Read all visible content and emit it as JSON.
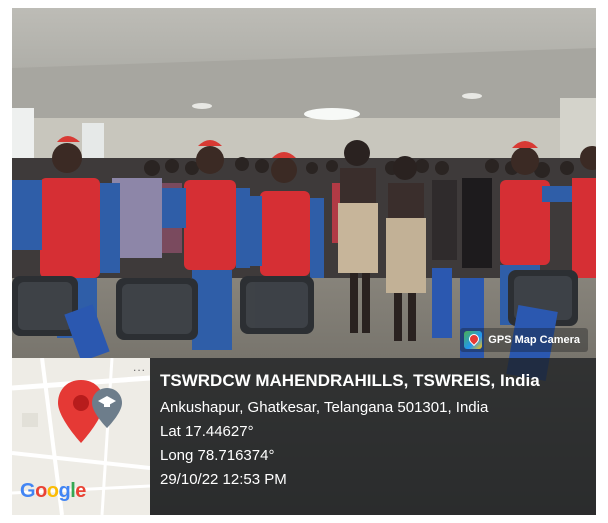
{
  "badge": {
    "label": "GPS Map Camera",
    "icon": "gps-map-camera-icon"
  },
  "location": {
    "title": "TSWRDCW MAHENDRAHILLS, TSWREIS, India",
    "address": "Ankushapur, Ghatkesar, Telangana 501301, India",
    "latitude": "Lat 17.44627°",
    "longitude": "Long 78.716374°",
    "datetime": "29/10/22 12:53 PM"
  },
  "map": {
    "logo_text": "Google",
    "more_text": "...",
    "pin_color": "#e53935",
    "secondary_pin_color": "#6d7d8b"
  },
  "colors": {
    "panel_background": "#1e2022",
    "text": "#ffffff"
  }
}
